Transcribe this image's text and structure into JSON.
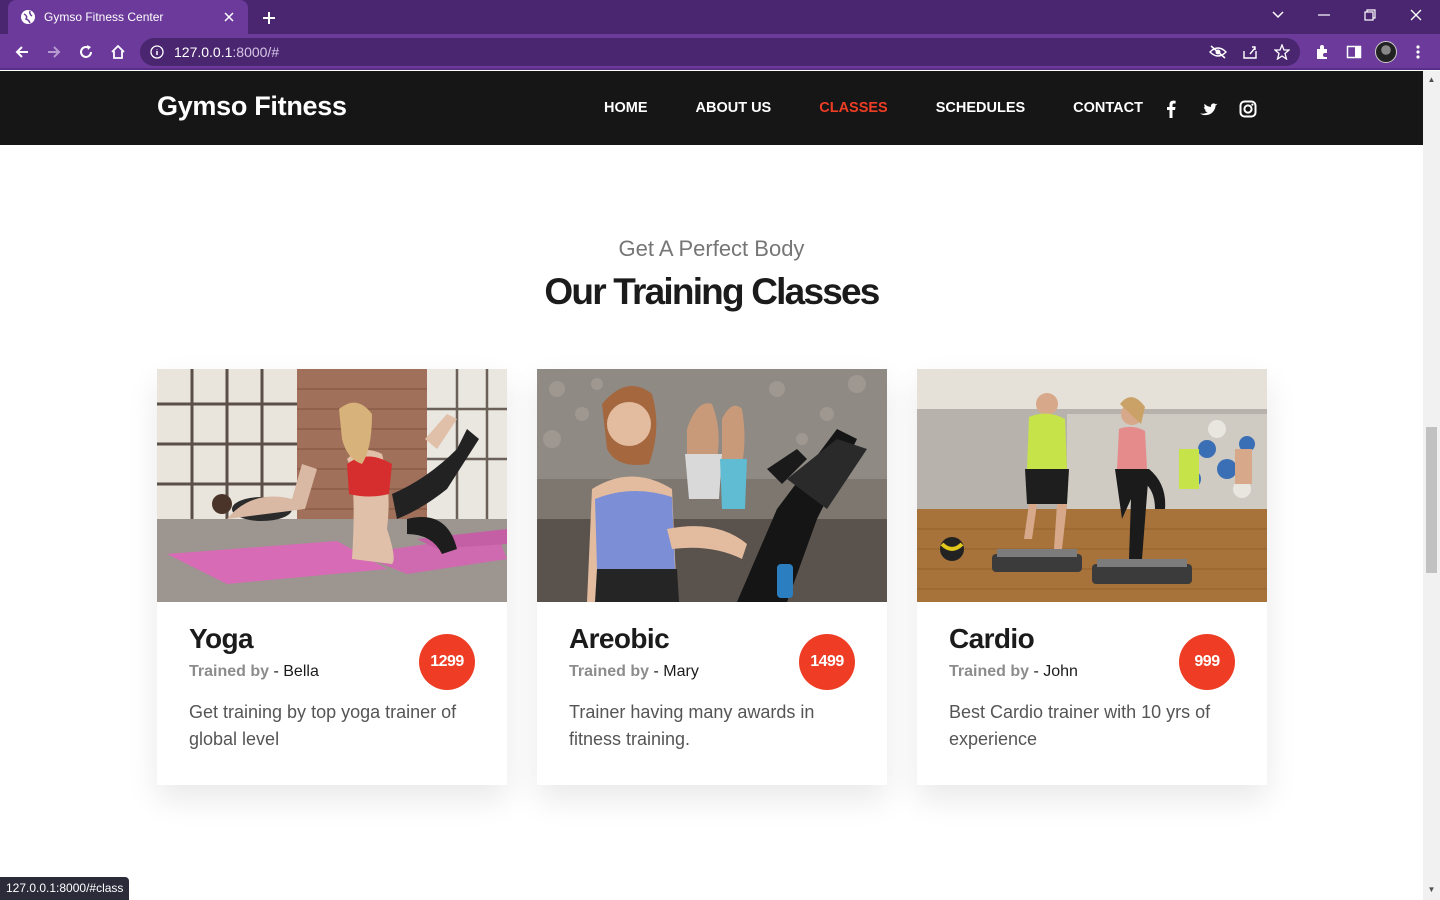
{
  "browser": {
    "tab_title": "Gymso Fitness Center",
    "url_host": "127.0.0.1",
    "url_path": ":8000/#",
    "status_url": "127.0.0.1:8000/#class"
  },
  "site": {
    "brand": "Gymso Fitness",
    "nav": [
      {
        "label": "HOME"
      },
      {
        "label": "ABOUT US"
      },
      {
        "label": "CLASSES",
        "active": true
      },
      {
        "label": "SCHEDULES"
      },
      {
        "label": "CONTACT"
      }
    ],
    "social": [
      "facebook-icon",
      "twitter-icon",
      "instagram-icon"
    ]
  },
  "section": {
    "subtitle": "Get A Perfect Body",
    "title": "Our Training Classes"
  },
  "classes": [
    {
      "title": "Yoga",
      "trained_by_label": "Trained by",
      "trainer": "- Bella",
      "price": "1299",
      "description": "Get training by top yoga trainer of global level"
    },
    {
      "title": "Areobic",
      "trained_by_label": "Trained by",
      "trainer": "- Mary",
      "price": "1499",
      "description": "Trainer having many awards in fitness training."
    },
    {
      "title": "Cardio",
      "trained_by_label": "Trained by",
      "trainer": "- John",
      "price": "999",
      "description": "Best Cardio trainer with 10 yrs of experience"
    }
  ],
  "colors": {
    "accent": "#ee3d24",
    "nav_bg": "#161616",
    "browser_purple": "#6b3a9a"
  }
}
